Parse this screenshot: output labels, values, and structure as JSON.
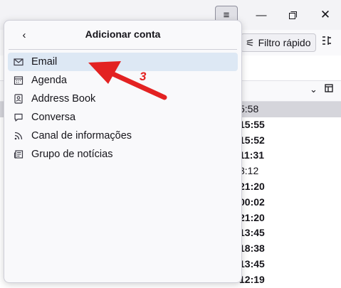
{
  "window": {
    "menu_icon": "hamburger-icon",
    "minimize_icon": "minimize-icon",
    "maximize_icon": "maximize-icon",
    "close_icon": "close-icon"
  },
  "toolbar": {
    "quick_filter_label": "Filtro rápido",
    "quick_filter_icon": "filter-icon",
    "more_icon": "layout-options-icon"
  },
  "message_list": {
    "rows": [
      {
        "time": "5:58",
        "selected": true,
        "unread": false
      },
      {
        "time": "15:55",
        "selected": false,
        "unread": true
      },
      {
        "time": "15:52",
        "selected": false,
        "unread": true
      },
      {
        "time": "11:31",
        "selected": false,
        "unread": true
      },
      {
        "time": "3:12",
        "selected": false,
        "unread": false
      },
      {
        "time": "21:20",
        "selected": false,
        "unread": true
      },
      {
        "time": "00:02",
        "selected": false,
        "unread": true
      },
      {
        "time": "21:20",
        "selected": false,
        "unread": true
      },
      {
        "time": "13:45",
        "selected": false,
        "unread": true
      },
      {
        "time": "18:38",
        "selected": false,
        "unread": true
      },
      {
        "time": "13:45",
        "selected": false,
        "unread": true
      },
      {
        "time": "12:19",
        "selected": false,
        "unread": true
      }
    ]
  },
  "panel": {
    "title": "Adicionar conta",
    "back_icon": "chevron-left-icon",
    "items": [
      {
        "label": "Email",
        "icon": "envelope-icon",
        "highlighted": true
      },
      {
        "label": "Agenda",
        "icon": "calendar-icon",
        "highlighted": false
      },
      {
        "label": "Address Book",
        "icon": "address-book-icon",
        "highlighted": false
      },
      {
        "label": "Conversa",
        "icon": "chat-icon",
        "highlighted": false
      },
      {
        "label": "Canal de informações",
        "icon": "rss-icon",
        "highlighted": false
      },
      {
        "label": "Grupo de notícias",
        "icon": "newsgroup-icon",
        "highlighted": false
      }
    ]
  },
  "annotation": {
    "step_number": "3",
    "color": "#e32222"
  }
}
